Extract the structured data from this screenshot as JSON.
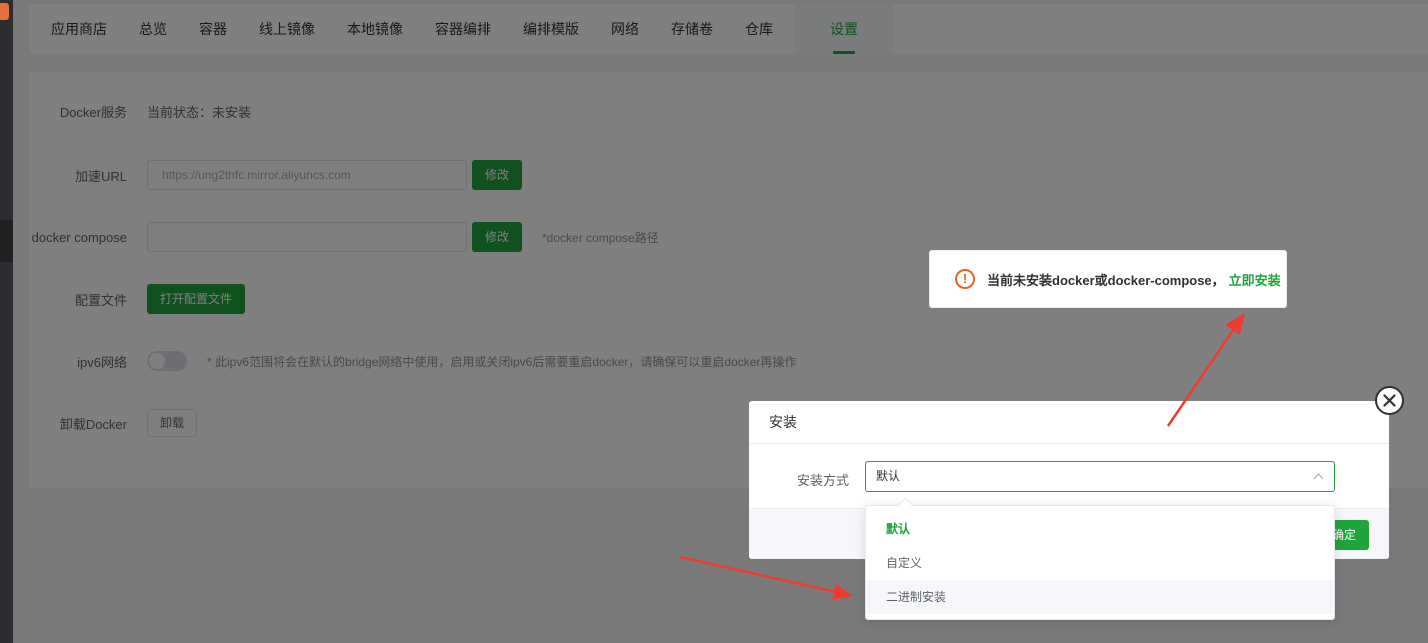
{
  "tabs": [
    "应用商店",
    "总览",
    "容器",
    "线上镜像",
    "本地镜像",
    "容器编排",
    "编排模版",
    "网络",
    "存储卷",
    "仓库",
    "设置"
  ],
  "active_tab": "设置",
  "settings": {
    "docker_service_label": "Docker服务",
    "docker_status": "当前状态：未安装",
    "mirror_label": "加速URL",
    "mirror_placeholder": "https://ung2thfc.mirror.aliyuncs.com",
    "modify_label": "修改",
    "compose_label": "docker compose",
    "compose_hint": "*docker compose路径",
    "config_label": "配置文件",
    "open_config_label": "打开配置文件",
    "ipv6_label": "ipv6网络",
    "ipv6_hint": "* 此ipv6范围将会在默认的bridge网络中使用，启用或关闭ipv6后需要重启docker，请确保可以重启docker再操作",
    "uninstall_label": "卸载Docker",
    "uninstall_button": "卸载"
  },
  "toast": {
    "message": "当前未安装docker或docker-compose，",
    "link": "立即安装"
  },
  "dialog": {
    "title": "安装",
    "field_label": "安装方式",
    "selected_value": "默认",
    "confirm_label": "确定",
    "options": [
      "默认",
      "自定义",
      "二进制安装"
    ]
  },
  "colors": {
    "accent": "#20a53a",
    "warning": "#e6612b",
    "annotation_arrow": "#ee3b30"
  },
  "icons": [
    "warning-circle-icon",
    "close-icon",
    "chevron-up-icon"
  ]
}
